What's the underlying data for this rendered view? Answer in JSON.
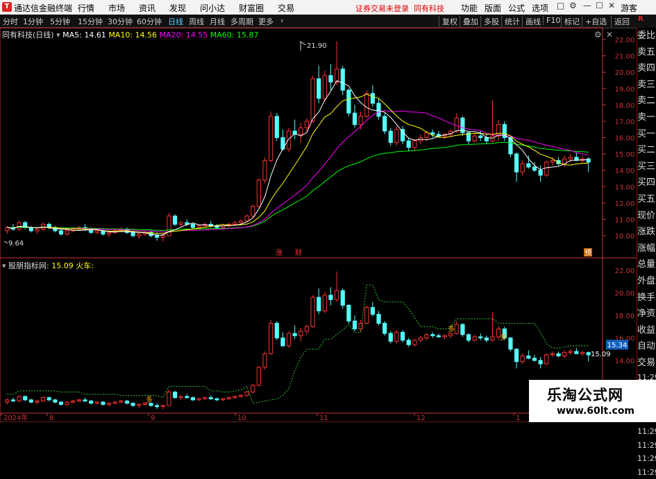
{
  "app": {
    "name": "通达信金融终端",
    "notice": "证券交易未登录",
    "notice2": "同有科技",
    "guest": "游客"
  },
  "menu": [
    "行情",
    "市场",
    "资讯",
    "发现",
    "问小达",
    "财富圈",
    "交易"
  ],
  "right_menu": [
    "功能",
    "版面",
    "公式",
    "选项"
  ],
  "window_controls": [
    "□",
    "—",
    "☐",
    "✕"
  ],
  "periods": [
    "分时",
    "1分钟",
    "5分钟",
    "15分钟",
    "30分钟",
    "60分钟",
    "日线",
    "周线",
    "月线",
    "多周期",
    "更多"
  ],
  "active_period": "日线",
  "right_tools": [
    "复权",
    "叠加",
    "多股",
    "统计",
    "画线",
    "F10",
    "标记",
    "+自选",
    "返回"
  ],
  "stock": {
    "title": "同有科技(日线)",
    "ma5": "MA5: 14.61",
    "ma10": "MA10: 14.56",
    "ma20": "MA20: 14.55",
    "ma60": "MA60: 15.87"
  },
  "indicator": {
    "name": "股朋指标网",
    "value": ": 15.09",
    "label": "火车:"
  },
  "side_panel": [
    "委比",
    "卖五",
    "卖四",
    "卖三",
    "卖二",
    "卖一",
    "买一",
    "买二",
    "买三",
    "买四",
    "买五",
    "现价",
    "涨跌",
    "涨幅",
    "总量",
    "外盘",
    "换手",
    "净资",
    "收益",
    "自动",
    "交易",
    "11:29",
    "11:29",
    "11:29",
    "11:29",
    "11:29",
    "11:29",
    "11:29",
    "11:29"
  ],
  "price_axis": [
    "22.00",
    "21.00",
    "20.00",
    "19.00",
    "18.00",
    "17.00",
    "16.00",
    "15.00",
    "14.00",
    "13.00",
    "12.00",
    "11.00",
    "10.00"
  ],
  "ind_axis": [
    "22.00",
    "20.00",
    "18.00",
    "16.00",
    "14.00"
  ],
  "ind_current": "15.34",
  "ind_last": "15.09",
  "annotations": {
    "high": "21.90",
    "low": "9.64",
    "zhang": "涨",
    "cai": "财",
    "yu": "预",
    "duo": "多"
  },
  "dates": [
    "2024年",
    "8",
    "9",
    "10",
    "11",
    "12",
    "1"
  ],
  "watermark": {
    "title": "乐淘公式网",
    "url": "www.60lt.com"
  },
  "colors": {
    "up": "#ff3232",
    "down": "#54ffff",
    "ma5": "#ffffff",
    "ma10": "#ffff00",
    "ma20": "#ff00ff",
    "ma60": "#00ff00",
    "grid": "#c33"
  },
  "chart_data": {
    "type": "candlestick",
    "series": [
      {
        "name": "MA5",
        "values": []
      },
      {
        "name": "MA10",
        "values": []
      },
      {
        "name": "MA20",
        "values": []
      },
      {
        "name": "MA60",
        "values": []
      }
    ],
    "ylim": [
      9.5,
      22.5
    ],
    "ohlc": [
      [
        10.3,
        10.6,
        10.1,
        10.5
      ],
      [
        10.5,
        10.7,
        10.3,
        10.4
      ],
      [
        10.4,
        10.9,
        10.3,
        10.8
      ],
      [
        10.8,
        10.9,
        10.4,
        10.5
      ],
      [
        10.5,
        10.6,
        10.2,
        10.3
      ],
      [
        10.3,
        10.5,
        10.1,
        10.4
      ],
      [
        10.4,
        10.8,
        10.3,
        10.7
      ],
      [
        10.7,
        10.8,
        10.4,
        10.5
      ],
      [
        10.5,
        10.6,
        10.2,
        10.3
      ],
      [
        10.3,
        10.4,
        10.0,
        10.1
      ],
      [
        10.1,
        10.4,
        10.0,
        10.3
      ],
      [
        10.3,
        10.5,
        10.2,
        10.4
      ],
      [
        10.4,
        10.6,
        10.3,
        10.5
      ],
      [
        10.5,
        10.7,
        10.3,
        10.4
      ],
      [
        10.4,
        10.5,
        10.1,
        10.2
      ],
      [
        10.2,
        10.4,
        10.1,
        10.3
      ],
      [
        10.3,
        10.4,
        10.0,
        10.1
      ],
      [
        10.1,
        10.3,
        9.9,
        10.2
      ],
      [
        10.2,
        10.4,
        10.1,
        10.3
      ],
      [
        10.3,
        10.5,
        10.2,
        10.4
      ],
      [
        10.4,
        10.5,
        10.1,
        10.2
      ],
      [
        10.2,
        10.3,
        9.9,
        10.0
      ],
      [
        10.0,
        10.2,
        9.8,
        10.1
      ],
      [
        10.1,
        10.3,
        10.0,
        10.2
      ],
      [
        10.2,
        10.3,
        9.9,
        10.0
      ],
      [
        10.0,
        10.2,
        9.7,
        9.9
      ],
      [
        9.9,
        10.1,
        9.64,
        10.0
      ],
      [
        10.0,
        11.4,
        10.0,
        11.2
      ],
      [
        11.2,
        11.3,
        10.6,
        10.7
      ],
      [
        10.7,
        10.9,
        10.5,
        10.8
      ],
      [
        10.8,
        11.0,
        10.6,
        10.7
      ],
      [
        10.7,
        10.8,
        10.4,
        10.5
      ],
      [
        10.5,
        10.7,
        10.4,
        10.6
      ],
      [
        10.6,
        10.8,
        10.5,
        10.7
      ],
      [
        10.7,
        10.9,
        10.5,
        10.6
      ],
      [
        10.6,
        10.7,
        10.4,
        10.5
      ],
      [
        10.5,
        10.7,
        10.4,
        10.6
      ],
      [
        10.6,
        10.8,
        10.5,
        10.7
      ],
      [
        10.7,
        10.9,
        10.6,
        10.8
      ],
      [
        10.8,
        11.0,
        10.7,
        10.9
      ],
      [
        10.9,
        11.3,
        10.8,
        11.2
      ],
      [
        11.2,
        11.9,
        11.1,
        11.8
      ],
      [
        11.8,
        13.5,
        11.7,
        13.4
      ],
      [
        13.4,
        14.8,
        13.2,
        14.6
      ],
      [
        14.6,
        17.6,
        14.5,
        17.3
      ],
      [
        17.3,
        17.5,
        15.8,
        16.0
      ],
      [
        16.0,
        16.5,
        15.2,
        15.3
      ],
      [
        15.3,
        16.6,
        15.1,
        16.4
      ],
      [
        16.4,
        17.1,
        15.9,
        16.2
      ],
      [
        16.2,
        16.9,
        15.7,
        16.6
      ],
      [
        16.6,
        17.2,
        16.3,
        17.0
      ],
      [
        17.0,
        19.8,
        16.9,
        19.6
      ],
      [
        19.6,
        20.4,
        18.1,
        18.4
      ],
      [
        18.4,
        20.1,
        18.2,
        19.8
      ],
      [
        19.8,
        20.5,
        18.9,
        19.4
      ],
      [
        19.4,
        21.9,
        19.2,
        20.2
      ],
      [
        20.2,
        20.4,
        18.6,
        18.9
      ],
      [
        18.9,
        19.0,
        17.3,
        17.5
      ],
      [
        17.5,
        18.0,
        16.6,
        16.8
      ],
      [
        16.8,
        17.6,
        16.5,
        17.3
      ],
      [
        17.3,
        18.9,
        17.2,
        18.7
      ],
      [
        18.7,
        19.2,
        17.9,
        18.1
      ],
      [
        18.1,
        18.4,
        17.1,
        17.3
      ],
      [
        17.3,
        17.5,
        16.2,
        16.4
      ],
      [
        16.4,
        16.6,
        15.5,
        15.7
      ],
      [
        15.7,
        16.7,
        15.5,
        16.5
      ],
      [
        16.5,
        16.7,
        15.6,
        15.8
      ],
      [
        15.8,
        16.0,
        15.2,
        15.4
      ],
      [
        15.4,
        15.9,
        15.2,
        15.8
      ],
      [
        15.8,
        16.2,
        15.6,
        16.0
      ],
      [
        16.0,
        16.4,
        15.8,
        16.3
      ],
      [
        16.3,
        16.5,
        16.0,
        16.2
      ],
      [
        16.2,
        16.4,
        16.0,
        16.1
      ],
      [
        16.1,
        16.3,
        15.9,
        16.2
      ],
      [
        16.2,
        16.5,
        16.0,
        16.4
      ],
      [
        16.4,
        17.5,
        16.3,
        17.2
      ],
      [
        17.2,
        17.3,
        16.1,
        16.3
      ],
      [
        16.3,
        16.4,
        15.6,
        15.8
      ],
      [
        15.8,
        16.3,
        15.7,
        16.1
      ],
      [
        16.1,
        16.4,
        15.8,
        16.0
      ],
      [
        16.0,
        16.2,
        15.6,
        15.8
      ],
      [
        15.8,
        18.3,
        15.7,
        16.1
      ],
      [
        16.1,
        17.1,
        15.8,
        16.8
      ],
      [
        16.8,
        17.0,
        15.8,
        16.0
      ],
      [
        16.0,
        16.1,
        14.8,
        15.0
      ],
      [
        15.0,
        15.1,
        13.3,
        13.9
      ],
      [
        13.9,
        14.6,
        13.7,
        14.4
      ],
      [
        14.4,
        14.9,
        14.1,
        14.2
      ],
      [
        14.2,
        14.5,
        13.9,
        14.0
      ],
      [
        14.0,
        14.3,
        13.3,
        13.7
      ],
      [
        13.7,
        14.6,
        13.6,
        14.5
      ],
      [
        14.5,
        14.8,
        14.3,
        14.6
      ],
      [
        14.6,
        14.8,
        14.3,
        14.4
      ],
      [
        14.4,
        14.9,
        14.2,
        14.7
      ],
      [
        14.7,
        15.0,
        14.5,
        14.8
      ],
      [
        14.8,
        15.1,
        14.6,
        14.6
      ],
      [
        14.6,
        14.9,
        14.4,
        14.7
      ],
      [
        14.7,
        14.8,
        13.9,
        14.5
      ]
    ]
  }
}
